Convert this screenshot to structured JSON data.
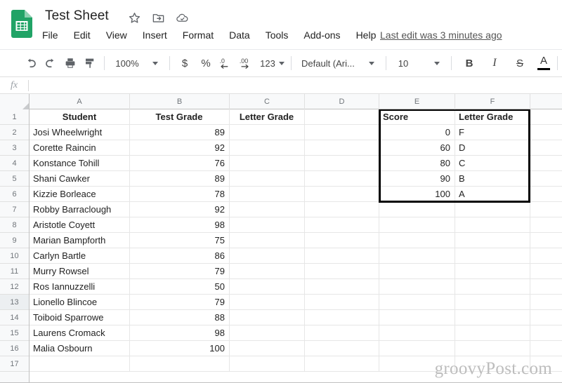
{
  "app": {
    "logo_icon": "google-sheets-logo",
    "doc_title": "Test Sheet",
    "title_icons": [
      {
        "name": "star-icon",
        "label": "Star"
      },
      {
        "name": "move-to-folder-icon",
        "label": "Move"
      },
      {
        "name": "cloud-saved-icon",
        "label": "Saved to Drive"
      }
    ],
    "menus": [
      "File",
      "Edit",
      "View",
      "Insert",
      "Format",
      "Data",
      "Tools",
      "Add-ons",
      "Help"
    ],
    "last_edit": "Last edit was 3 minutes ago"
  },
  "toolbar": {
    "undo_icon": "undo-icon",
    "redo_icon": "redo-icon",
    "print_icon": "print-icon",
    "paint_format_icon": "paint-format-icon",
    "zoom_value": "100%",
    "currency_label": "$",
    "percent_label": "%",
    "decrease_decimal_label": ".0",
    "increase_decimal_label": ".00",
    "more_formats_label": "123",
    "font_value": "Default (Ari...",
    "font_size_value": "10",
    "bold_label": "B",
    "italic_label": "I",
    "strikethrough_label": "S",
    "text_color_label": "A",
    "fill_color_icon": "fill-color-icon",
    "borders_icon": "borders-icon"
  },
  "formula_bar": {
    "fx_label": "fx",
    "value": "",
    "placeholder": ""
  },
  "grid": {
    "columns": [
      "A",
      "B",
      "C",
      "D",
      "E",
      "F"
    ],
    "rows": [
      "1",
      "2",
      "3",
      "4",
      "5",
      "6",
      "7",
      "8",
      "9",
      "10",
      "11",
      "12",
      "13",
      "14",
      "15",
      "16",
      "17"
    ],
    "highlighted_row": "13",
    "table_main": {
      "headers": [
        "Student",
        "Test Grade",
        "Letter Grade"
      ],
      "rows": [
        {
          "student": "Josi Wheelwright",
          "grade": "89",
          "letter": ""
        },
        {
          "student": "Corette Raincin",
          "grade": "92",
          "letter": ""
        },
        {
          "student": "Konstance Tohill",
          "grade": "76",
          "letter": ""
        },
        {
          "student": "Shani Cawker",
          "grade": "89",
          "letter": ""
        },
        {
          "student": "Kizzie Borleace",
          "grade": "78",
          "letter": ""
        },
        {
          "student": "Robby Barraclough",
          "grade": "92",
          "letter": ""
        },
        {
          "student": "Aristotle Coyett",
          "grade": "98",
          "letter": ""
        },
        {
          "student": "Marian Bampforth",
          "grade": "75",
          "letter": ""
        },
        {
          "student": "Carlyn Bartle",
          "grade": "86",
          "letter": ""
        },
        {
          "student": "Murry Rowsel",
          "grade": "79",
          "letter": ""
        },
        {
          "student": "Ros Iannuzzelli",
          "grade": "50",
          "letter": ""
        },
        {
          "student": "Lionello Blincoe",
          "grade": "79",
          "letter": ""
        },
        {
          "student": "Toiboid Sparrowe",
          "grade": "88",
          "letter": ""
        },
        {
          "student": "Laurens Cromack",
          "grade": "98",
          "letter": ""
        },
        {
          "student": "Malia Osbourn",
          "grade": "100",
          "letter": ""
        }
      ]
    },
    "table_lookup": {
      "headers": [
        "Score",
        "Letter Grade"
      ],
      "rows": [
        {
          "score": "0",
          "letter": "F"
        },
        {
          "score": "60",
          "letter": "D"
        },
        {
          "score": "80",
          "letter": "C"
        },
        {
          "score": "90",
          "letter": "B"
        },
        {
          "score": "100",
          "letter": "A"
        }
      ],
      "selection_range": "E1:F6"
    }
  },
  "watermark": "groovyPost.com"
}
